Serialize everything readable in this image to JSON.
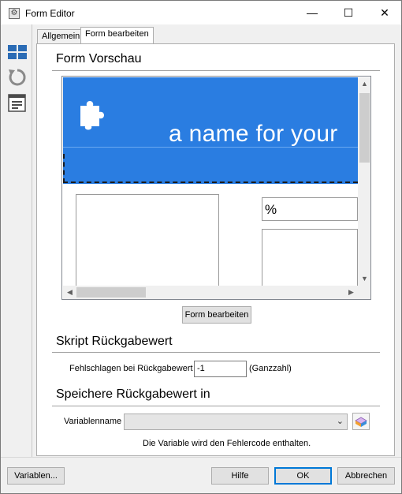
{
  "window": {
    "title": "Form Editor",
    "minimize": "—",
    "maximize": "☐",
    "close": "✕"
  },
  "toolbar": {
    "items": [
      "layout-icon",
      "refresh-icon",
      "form-icon"
    ]
  },
  "tabs": [
    {
      "label": "Allgemein",
      "active": false
    },
    {
      "label": "Form bearbeiten",
      "active": true
    }
  ],
  "preview_section": {
    "title": "Form Vorschau",
    "banner_text": "a name for your",
    "field_value": "%",
    "edit_button": "Form bearbeiten"
  },
  "script_section": {
    "title": "Skript Rückgabewert",
    "fail_label": "Fehlschlagen bei Rückgabewert",
    "fail_value": "-1",
    "fail_unit": "(Ganzzahl)"
  },
  "store_section": {
    "title": "Speichere Rückgabewert in",
    "variable_label": "Variablenname",
    "variable_value": "",
    "hint": "Die Variable wird den Fehlercode enthalten."
  },
  "footer": {
    "variables_button": "Variablen...",
    "help_button": "Hilfe",
    "ok_button": "OK",
    "cancel_button": "Abbrechen"
  },
  "colors": {
    "banner": "#2a7de1",
    "accent": "#0078d7"
  }
}
